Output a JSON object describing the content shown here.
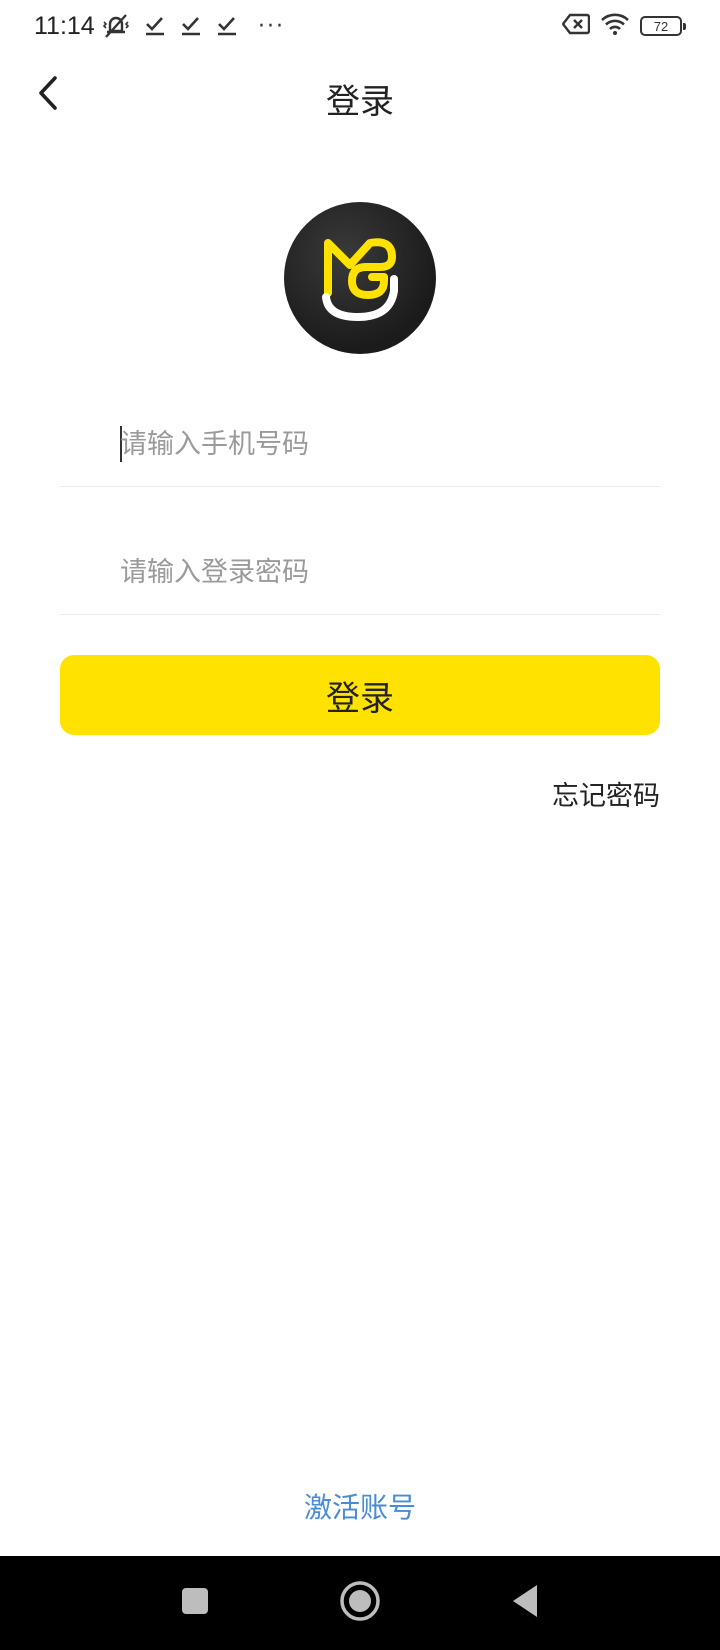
{
  "status_bar": {
    "time": "11:14",
    "more": "···",
    "battery": "72"
  },
  "header": {
    "title": "登录"
  },
  "form": {
    "phone_placeholder": "请输入手机号码",
    "password_placeholder": "请输入登录密码",
    "login_label": "登录",
    "forgot_label": "忘记密码"
  },
  "footer": {
    "activate_label": "激活账号"
  },
  "colors": {
    "accent": "#ffe200",
    "link": "#4a8bd6",
    "logo_bg": "#222222",
    "nav_bg": "#000000"
  },
  "icons": {
    "back": "chevron-left-icon",
    "logo": "mg-logo-icon",
    "home": "circle-home-icon",
    "recents": "square-recents-icon",
    "system_back": "triangle-back-icon"
  }
}
